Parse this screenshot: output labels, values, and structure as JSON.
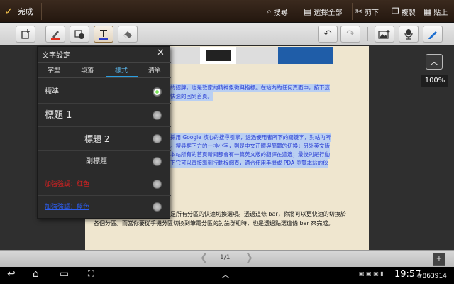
{
  "topbar": {
    "done_label": "完成",
    "actions": [
      {
        "label": "搜尋",
        "icon": "search-icon"
      },
      {
        "label": "選擇全部",
        "icon": "select-all-icon"
      },
      {
        "label": "剪下",
        "icon": "scissors-icon"
      },
      {
        "label": "複製",
        "icon": "copy-icon"
      },
      {
        "label": "貼上",
        "icon": "paste-icon"
      }
    ]
  },
  "toolbar": {
    "tools": [
      "page-add-icon",
      "pen-icon",
      "shape-icon",
      "text-icon",
      "eraser-icon"
    ],
    "right_tools": [
      "undo-icon",
      "redo-icon",
      "insert-image-icon",
      "microphone-icon",
      "pencil-icon"
    ]
  },
  "popup": {
    "title": "文字設定",
    "tabs": [
      "字型",
      "段落",
      "樣式",
      "清單"
    ],
    "active_tab": "樣式",
    "styles": [
      {
        "label": "標準",
        "selected": true
      },
      {
        "label": "標題 1",
        "selected": false
      },
      {
        "label": "標題 2",
        "selected": false
      },
      {
        "label": "副標題",
        "selected": false
      },
      {
        "label": "加強強調：紅色",
        "selected": false
      },
      {
        "label": "加強強調：藍色",
        "selected": false
      }
    ]
  },
  "document": {
    "line1a": "的招牌，也是敦家的精神象徵與指標。在站內的任何頁面中，按下這",
    "line1b": "快速的回到首頁。",
    "line2a": "採用 Google 核心的搜尋引擎，透過使用者所下的關鍵字，對站內所",
    "line2b": "。搜尋框下方的一排小字，則是中文正體與簡體的切換；另外英文版",
    "line2c": "本站所有的首頁新聞都會有一篇英文版的翻譯在這邊；最後則是行動",
    "line2d": "下它可以直接導到行動板網頁，適合使用手機或 PDA 瀏覽本站的伙",
    "para1": "是所有分區的快速切換選項。透過這條  bar，你將可以更快速的切換於",
    "para2": "各個分區。而當你要從手機分區切換到筆電分區的討論群組時，也是透過點選這條 bar 來完成。"
  },
  "zoom_label": "100%",
  "pager": {
    "page_indicator": "1/1"
  },
  "system": {
    "time": "19:57",
    "watermark": "#863914"
  },
  "colors": {
    "accent_blue": "#2b9ee0",
    "highlight_text": "#2a3fd4",
    "highlight_bg": "#b9cff2",
    "emphasis_red": "#e02020",
    "emphasis_blue": "#2c5ef0",
    "page_bg": "#efe6cf"
  }
}
